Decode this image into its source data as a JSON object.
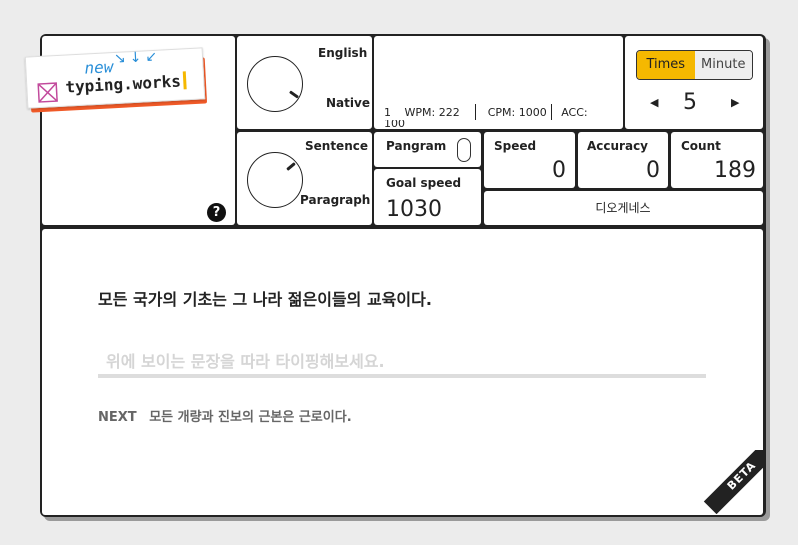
{
  "logo": {
    "new": "new",
    "name": "typing.works"
  },
  "language_knob": {
    "top_label": "English",
    "bottom_label": "Native"
  },
  "mode_knob": {
    "top_label": "Sentence",
    "bottom_label": "Paragraph"
  },
  "stats": {
    "level": "1",
    "wpm": "WPM: 222",
    "cpm": "CPM: 1000",
    "acc": "ACC:",
    "acc_value": "100"
  },
  "unit_toggle": {
    "options": [
      "Times",
      "Minute"
    ],
    "selected": "Times"
  },
  "count_stepper": {
    "value": "5"
  },
  "pangram": {
    "label": "Pangram",
    "enabled": false
  },
  "goal_speed": {
    "label": "Goal speed",
    "value": "1030"
  },
  "speed": {
    "label": "Speed",
    "value": "0"
  },
  "accuracy": {
    "label": "Accuracy",
    "value": "0"
  },
  "count": {
    "label": "Count",
    "value": "189"
  },
  "source": "디오게네스",
  "typing": {
    "sentence": "모든 국가의 기초는 그 나라 젊은이들의 교육이다.",
    "placeholder": "위에 보이는 문장을 따라 타이핑해보세요.",
    "input_value": "",
    "next_label": "NEXT",
    "next_sentence": "모든 개량과 진보의 근본은 근로이다."
  },
  "badge": "BETA",
  "colors": {
    "accent": "#f5b800",
    "brand": "#f05a28",
    "logo_blue": "#2a8fd8"
  }
}
